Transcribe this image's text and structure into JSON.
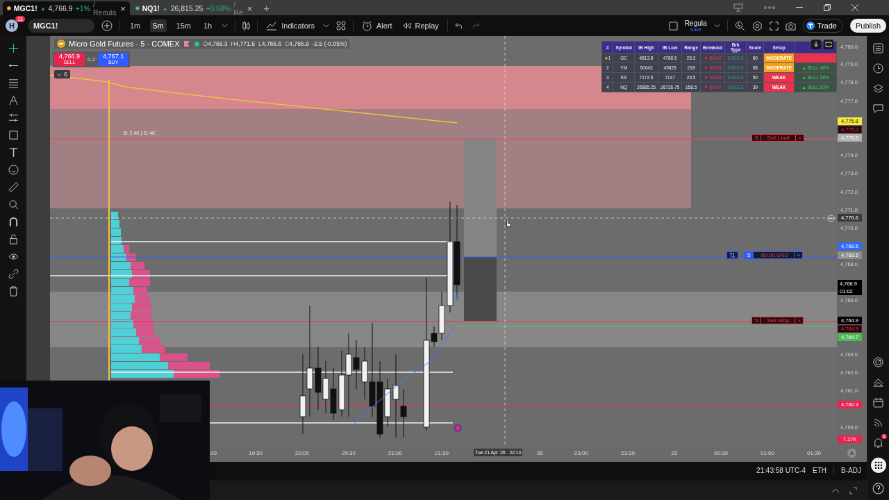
{
  "tabs": [
    {
      "symbol": "MGC1!",
      "arrow": "▲",
      "price": "4,766.9",
      "change": "+1%",
      "suffix": "/ Regula",
      "close": "×",
      "selected": true
    },
    {
      "symbol": "NQ1!",
      "arrow": "▲",
      "price": "26,815.25",
      "change": "+0.68%",
      "suffix": "/ Re",
      "close": "×",
      "selected": false
    }
  ],
  "new_tab": "+",
  "toolbar": {
    "avatar": "H",
    "notifications": "11",
    "symbol": "MGC1!",
    "intervals": [
      {
        "label": "1m",
        "selected": false
      },
      {
        "label": "5m",
        "selected": true
      },
      {
        "label": "15m",
        "selected": false
      },
      {
        "label": "1h",
        "selected": false
      }
    ],
    "indicators": "Indicators",
    "alert": "Alert",
    "replay": "Replay",
    "layout_name": "Regula",
    "layout_status": "Save",
    "trade": "Trade",
    "publish": "Publish"
  },
  "legend": {
    "title": "Micro Gold Futures · 5 · COMEX",
    "ohlc": [
      {
        "key": "O",
        "value": "4,769.3"
      },
      {
        "key": "H",
        "value": "4,771.5"
      },
      {
        "key": "L",
        "value": "4,766.6"
      },
      {
        "key": "C",
        "value": "4,766.9"
      }
    ],
    "change": "-2.5 (-0.05%)",
    "sell_price": "4,766.9",
    "sell_label": "SELL",
    "spread": "0.2",
    "buy_price": "4,767.1",
    "buy_label": "BUY",
    "collapsed_count": "6"
  },
  "annotations": [
    {
      "text": "B: 2.4K | S: 4K"
    }
  ],
  "orders": [
    {
      "kind": "order",
      "qty": "5",
      "label": "Sell Limit",
      "close": "×"
    },
    {
      "kind": "position",
      "qty": "5",
      "label": "-80.00 USD",
      "close": "×"
    },
    {
      "kind": "order",
      "qty": "5",
      "label": "Sell Stop",
      "close": "×"
    }
  ],
  "ib_table": {
    "columns": [
      "#",
      "Symbol",
      "IB High",
      "IB Low",
      "Range",
      "Breakout",
      "Brk Type",
      "Score",
      "Setup"
    ],
    "rows": [
      {
        "star": "★",
        "rank": "1",
        "symbol": "GC",
        "ib_high": "4813.8",
        "ib_low": "4788.5",
        "range": "25.3",
        "breakout": "▼ BEAR",
        "brk_type": "SINGLE",
        "score": "60",
        "setup": {
          "label": "MODERATE",
          "color": "#f2a21e"
        },
        "bias": {
          "color": "#e8334f"
        }
      },
      {
        "rank": "2",
        "symbol": "YM",
        "ib_high": "50043",
        "ib_low": "49825",
        "range": "218",
        "breakout": "▼ BEAR",
        "brk_type": "SINGLE",
        "score": "58",
        "setup": {
          "label": "MODERATE",
          "color": "#f2a21e"
        },
        "bias": {
          "color": "#3d5246",
          "label": "▲ BULL 46%"
        }
      },
      {
        "rank": "3",
        "symbol": "ES",
        "ib_high": "7172.5",
        "ib_low": "7147",
        "range": "25.5",
        "breakout": "▼ BEAR",
        "brk_type": "SINGLE",
        "score": "50",
        "setup": {
          "label": "WEAK",
          "color": "#e8334f"
        },
        "bias": {
          "color": "#3d5246",
          "label": "▲ BULL 58%"
        }
      },
      {
        "rank": "4",
        "symbol": "NQ",
        "ib_high": "26885.25",
        "ib_low": "26726.75",
        "range": "158.5",
        "breakout": "▼ BEAR",
        "brk_type": "SINGLE",
        "score": "30",
        "setup": {
          "label": "WEAK",
          "color": "#e8334f"
        },
        "bias": {
          "color": "#3d5246",
          "label": "▲ BULL 83%"
        }
      }
    ]
  },
  "price_axis": [
    {
      "kind": "tick",
      "text": "4,780.0"
    },
    {
      "kind": "tick",
      "text": "4,779.0"
    },
    {
      "kind": "tick",
      "text": "4,778.0"
    },
    {
      "kind": "tick",
      "text": "4,777.0"
    },
    {
      "kind": "badge",
      "text": "4,775.8",
      "color": "#f5e83c"
    },
    {
      "kind": "outline",
      "text": "4,775.0"
    },
    {
      "kind": "badge",
      "text": "4,775.0",
      "color": "#b0b0b0"
    },
    {
      "kind": "tick",
      "text": "4,774.0"
    },
    {
      "kind": "tick",
      "text": "4,773.0"
    },
    {
      "kind": "tick",
      "text": "4,772.0"
    },
    {
      "kind": "tick",
      "text": "4,771.0"
    },
    {
      "kind": "crosshair",
      "text": "4,770.6"
    },
    {
      "kind": "tick",
      "text": "4,770.0"
    },
    {
      "kind": "badge",
      "text": "4,768.5",
      "color": "#2f6bff"
    },
    {
      "kind": "badge",
      "text": "4,768.5",
      "color": "#8e8e8e"
    },
    {
      "kind": "tick",
      "text": "4,768.0"
    },
    {
      "kind": "last",
      "text": "4,766.9",
      "countdown": "01:02"
    },
    {
      "kind": "tick",
      "text": "4,766.0"
    },
    {
      "kind": "badge",
      "text": "4,764.9",
      "color": "#000000"
    },
    {
      "kind": "outline",
      "text": "4,764.9"
    },
    {
      "kind": "badge",
      "text": "4,764.7",
      "color": "#4cbb55"
    },
    {
      "kind": "tick",
      "text": "4,763.0"
    },
    {
      "kind": "tick",
      "text": "4,762.0"
    },
    {
      "kind": "tick",
      "text": "4,761.0"
    },
    {
      "kind": "badge",
      "text": "4,760.3",
      "color": "#e8234f"
    },
    {
      "kind": "tick",
      "text": "4,759.0"
    },
    {
      "kind": "badge",
      "text": "7.17K",
      "color": "#e8234f"
    }
  ],
  "time_axis": {
    "ticks": [
      "00",
      "19:30",
      "20:00",
      "20:30",
      "21:00",
      "21:30",
      "30",
      "23:00",
      "23:30",
      "22",
      "00:30",
      "01:00",
      "01:30"
    ],
    "crosshair": "Tue 21 Apr '26   22:10",
    "auto": "A"
  },
  "status_bar": {
    "time": "21:43:58 UTC-4",
    "session": "ETH",
    "adjustment": "B-ADJ"
  },
  "sidebar_alerts": "1"
}
